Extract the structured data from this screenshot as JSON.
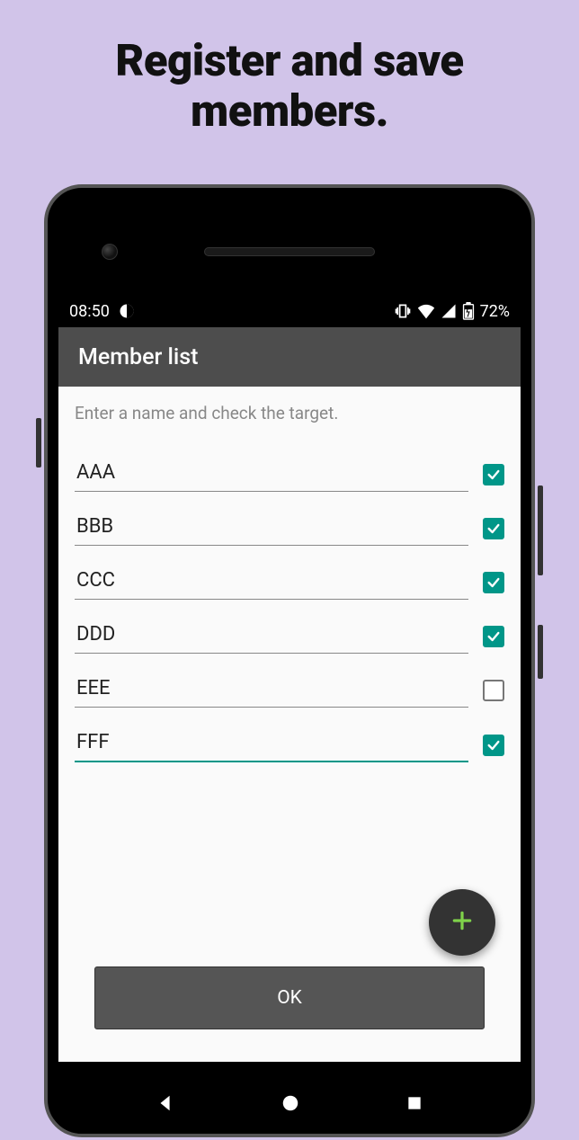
{
  "hero": {
    "title": "Register and save members."
  },
  "statusbar": {
    "time": "08:50",
    "battery_text": "72%"
  },
  "app": {
    "title": "Member list",
    "hint": "Enter a name and check the target.",
    "ok_label": "OK"
  },
  "members": [
    {
      "name": "AAA",
      "checked": true,
      "focused": false
    },
    {
      "name": "BBB",
      "checked": true,
      "focused": false
    },
    {
      "name": "CCC",
      "checked": true,
      "focused": false
    },
    {
      "name": "DDD",
      "checked": true,
      "focused": false
    },
    {
      "name": "EEE",
      "checked": false,
      "focused": false
    },
    {
      "name": "FFF",
      "checked": true,
      "focused": true
    }
  ],
  "colors": {
    "accent": "#009688",
    "fab_plus": "#7fd24a"
  }
}
